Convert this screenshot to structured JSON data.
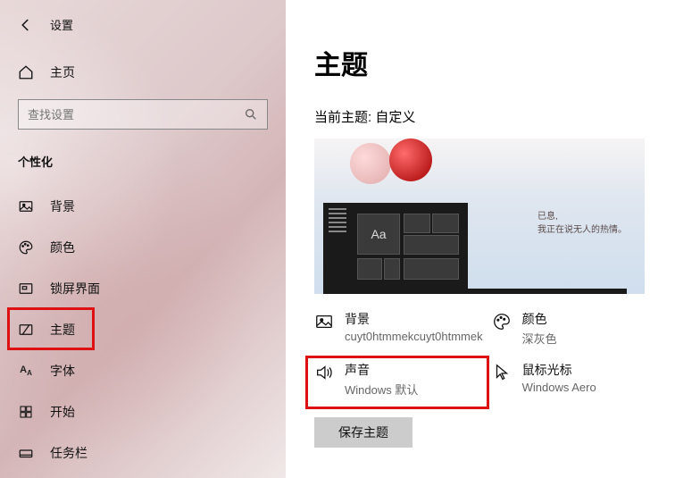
{
  "app_title": "设置",
  "home_label": "主页",
  "search_placeholder": "查找设置",
  "category": "个性化",
  "nav": [
    {
      "key": "background",
      "label": "背景"
    },
    {
      "key": "colors",
      "label": "颜色"
    },
    {
      "key": "lockscreen",
      "label": "锁屏界面"
    },
    {
      "key": "themes",
      "label": "主题"
    },
    {
      "key": "fonts",
      "label": "字体"
    },
    {
      "key": "start",
      "label": "开始"
    },
    {
      "key": "taskbar",
      "label": "任务栏"
    }
  ],
  "page_title": "主题",
  "current_theme_label": "当前主题: 自定义",
  "preview_caption_line1": "已息,",
  "preview_caption_line2": "我正在说无人的热情。",
  "aa_label": "Aa",
  "theme_options": {
    "background": {
      "label": "背景",
      "value": "cuyt0htmmekcuyt0htmmek"
    },
    "color": {
      "label": "颜色",
      "value": "深灰色"
    },
    "sound": {
      "label": "声音",
      "value": "Windows 默认"
    },
    "cursor": {
      "label": "鼠标光标",
      "value": "Windows Aero"
    }
  },
  "save_button": "保存主题"
}
